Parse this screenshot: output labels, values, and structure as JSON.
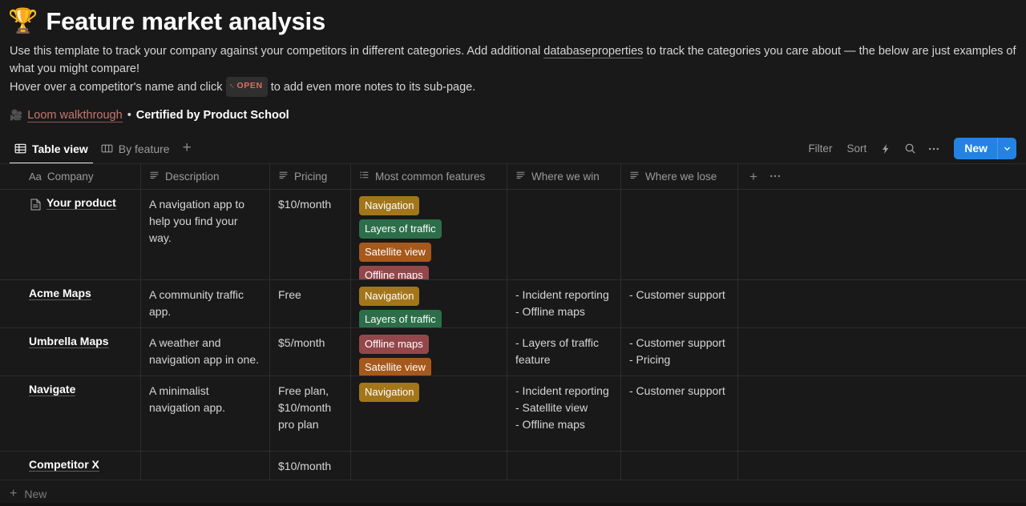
{
  "header": {
    "emoji": "🏆",
    "title": "Feature market analysis",
    "intro_line1_a": "Use this template to track your company against your competitors in different categories. Add additional ",
    "intro_link1": "database",
    "intro_link2": "properties",
    "intro_line2_b": " to track the categories you care about — the below are just examples of what you might compare!",
    "intro_line3_a": "Hover over a competitor's name and click ",
    "open_badge_label": "OPEN",
    "intro_line3_b": " to add even more notes to its sub-page."
  },
  "credit": {
    "emoji": "🎥",
    "link": "Loom walkthrough",
    "separator": "•",
    "text": "Certified by Product School"
  },
  "toolbar": {
    "views": [
      {
        "label": "Table view",
        "icon": "table-icon",
        "active": true
      },
      {
        "label": "By feature",
        "icon": "board-icon",
        "active": false
      }
    ],
    "add_view_label": "+",
    "filter_label": "Filter",
    "sort_label": "Sort",
    "automation_icon": "lightning-icon",
    "search_icon": "search-icon",
    "more_icon": "ellipsis-icon",
    "new_label": "New",
    "new_caret_icon": "chevron-down-icon"
  },
  "table": {
    "columns": [
      {
        "label": "Company",
        "icon": "title-aa-icon"
      },
      {
        "label": "Description",
        "icon": "text-icon"
      },
      {
        "label": "Pricing",
        "icon": "text-icon"
      },
      {
        "label": "Most common features",
        "icon": "multi-select-icon"
      },
      {
        "label": "Where we win",
        "icon": "text-icon"
      },
      {
        "label": "Where we lose",
        "icon": "text-icon"
      }
    ],
    "add_column_label": "+",
    "column_more_label": "•••",
    "rows": [
      {
        "company": "Your product",
        "has_page_icon": true,
        "description": "A navigation app to help you find your way.",
        "pricing": "$10/month",
        "features": [
          {
            "label": "Navigation",
            "color": "#a3761b"
          },
          {
            "label": "Layers of traffic",
            "color": "#2c6e49"
          },
          {
            "label": "Satellite view",
            "color": "#a5591c"
          },
          {
            "label": "Offline maps",
            "color": "#94474a"
          }
        ],
        "where_we_win": "",
        "where_we_lose": ""
      },
      {
        "company": "Acme Maps",
        "has_page_icon": false,
        "description": "A community traffic app.",
        "pricing": "Free",
        "features": [
          {
            "label": "Navigation",
            "color": "#a3761b"
          },
          {
            "label": "Layers of traffic",
            "color": "#2c6e49"
          }
        ],
        "where_we_win": "- Incident reporting\n- Offline maps",
        "where_we_lose": "- Customer support"
      },
      {
        "company": "Umbrella Maps",
        "has_page_icon": false,
        "description": "A weather and navigation app in one.",
        "pricing": "$5/month",
        "features": [
          {
            "label": "Offline maps",
            "color": "#94474a"
          },
          {
            "label": "Satellite view",
            "color": "#a5591c"
          }
        ],
        "where_we_win": "- Layers of traffic feature",
        "where_we_lose": "- Customer support\n- Pricing"
      },
      {
        "company": "Navigate",
        "has_page_icon": false,
        "description": "A minimalist navigation app.",
        "pricing": "Free plan, $10/month pro plan",
        "features": [
          {
            "label": "Navigation",
            "color": "#a3761b"
          }
        ],
        "where_we_win": "- Incident reporting\n- Satellite view\n- Offline maps",
        "where_we_lose": "- Customer support"
      },
      {
        "company": "Competitor X",
        "has_page_icon": false,
        "description": "",
        "pricing": "$10/month",
        "features": [],
        "where_we_win": "",
        "where_we_lose": ""
      }
    ],
    "new_row_label": "New",
    "new_row_plus": "+"
  },
  "colors": {
    "accent": "#2383e2",
    "background": "#191919",
    "border": "#2d2d2d",
    "link_red": "#c5766f"
  }
}
